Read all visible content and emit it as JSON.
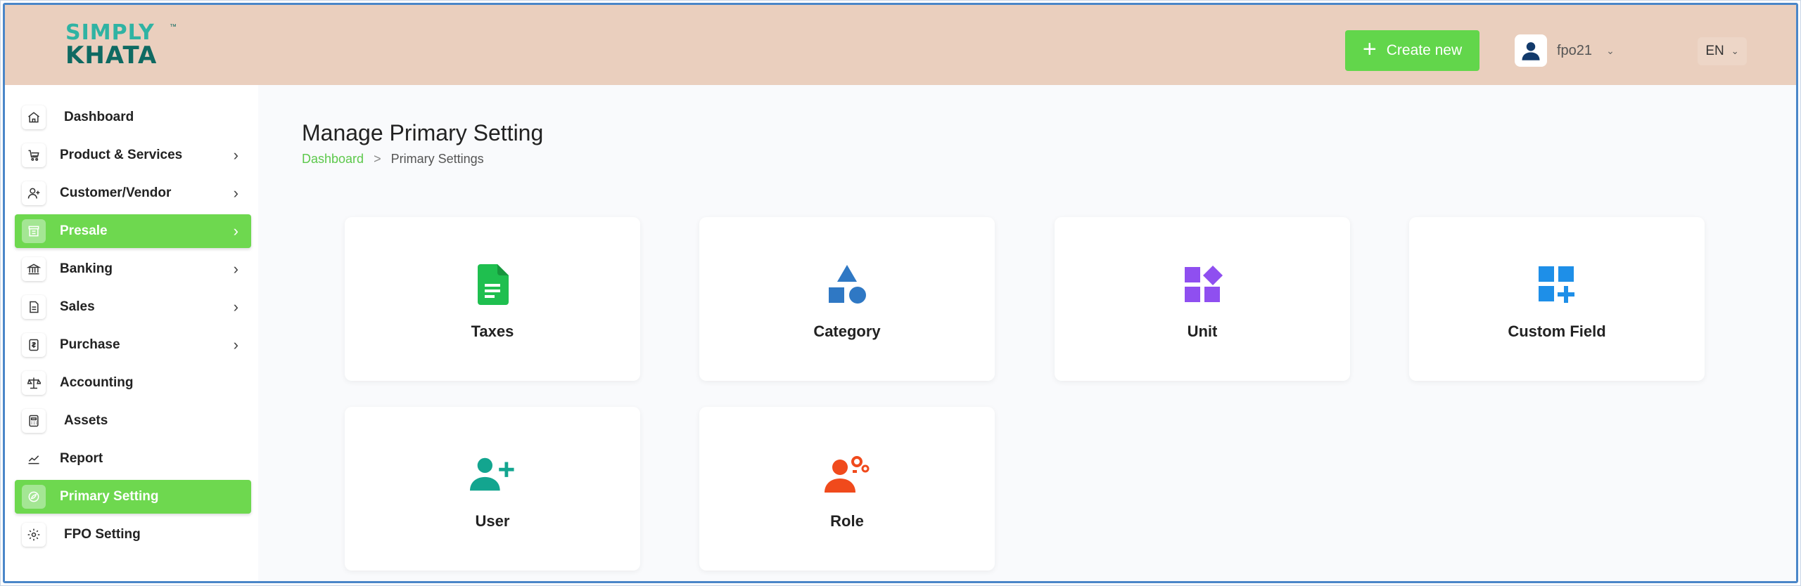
{
  "header": {
    "logo_line1": "SIMPLY",
    "logo_line2": "KHATA",
    "logo_tm": "™",
    "create_label": "Create new",
    "username": "fpo21",
    "language": "EN"
  },
  "sidebar": {
    "items": [
      {
        "label": "Dashboard",
        "icon": "home-icon",
        "has_arrow": false,
        "active": false
      },
      {
        "label": "Product & Services",
        "icon": "cart-icon",
        "has_arrow": true,
        "active": false
      },
      {
        "label": "Customer/Vendor",
        "icon": "user-add-icon",
        "has_arrow": true,
        "active": false
      },
      {
        "label": "Presale",
        "icon": "store-icon",
        "has_arrow": true,
        "active": true
      },
      {
        "label": "Banking",
        "icon": "bank-icon",
        "has_arrow": true,
        "active": false
      },
      {
        "label": "Sales",
        "icon": "document-icon",
        "has_arrow": true,
        "active": false
      },
      {
        "label": "Purchase",
        "icon": "receipt-icon",
        "has_arrow": true,
        "active": false
      },
      {
        "label": "Accounting",
        "icon": "scale-icon",
        "has_arrow": false,
        "active": false
      },
      {
        "label": "Assets",
        "icon": "calculator-icon",
        "has_arrow": false,
        "active": false
      },
      {
        "label": "Report",
        "icon": "chart-icon",
        "has_arrow": false,
        "active": false
      },
      {
        "label": "Primary Setting",
        "icon": "settings-leaf-icon",
        "has_arrow": false,
        "active": true
      },
      {
        "label": "FPO Setting",
        "icon": "gear-icon",
        "has_arrow": false,
        "active": false
      }
    ]
  },
  "main": {
    "title": "Manage Primary Setting",
    "breadcrumb": {
      "link": "Dashboard",
      "separator": ">",
      "current": "Primary Settings"
    },
    "cards": [
      {
        "label": "Taxes",
        "icon": "file-text-icon",
        "color": "#1fbf4f"
      },
      {
        "label": "Category",
        "icon": "shapes-icon",
        "color": "#2f78c4"
      },
      {
        "label": "Unit",
        "icon": "widgets-icon",
        "color": "#8f4ff0"
      },
      {
        "label": "Custom Field",
        "icon": "grid-add-icon",
        "color": "#1e8fe8"
      },
      {
        "label": "User",
        "icon": "user-plus-icon",
        "color": "#13a58f"
      },
      {
        "label": "Role",
        "icon": "user-gear-icon",
        "color": "#f04a1c"
      }
    ]
  },
  "colors": {
    "header_bg": "#eacfbe",
    "accent_green": "#62d64b",
    "breadcrumb_link": "#5cc84b",
    "frame_border": "#4a86c8"
  }
}
